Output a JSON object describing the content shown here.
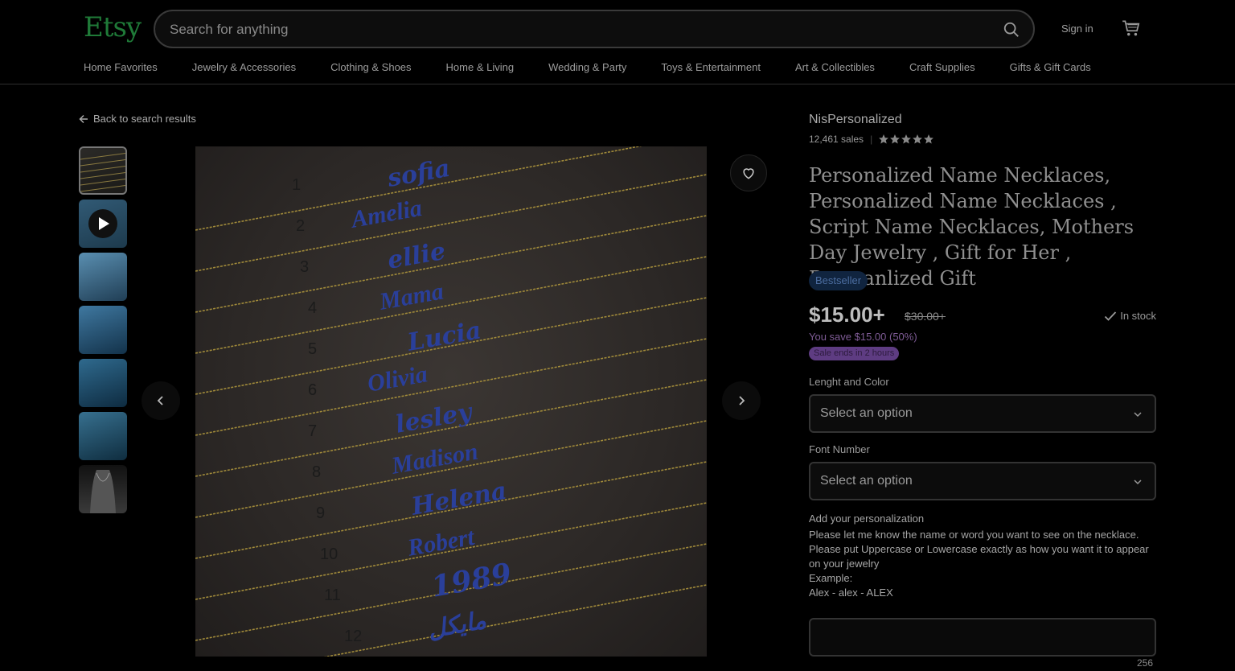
{
  "header": {
    "logo": "Etsy",
    "search_placeholder": "Search for anything",
    "sign_in": "Sign in"
  },
  "nav": [
    "Home Favorites",
    "Jewelry & Accessories",
    "Clothing & Shoes",
    "Home & Living",
    "Wedding & Party",
    "Toys & Entertainment",
    "Art & Collectibles",
    "Craft Supplies",
    "Gifts & Gift Cards"
  ],
  "back_link": "Back to search results",
  "gallery": {
    "thumbnail_count": 7,
    "image_labels": [
      {
        "num": "1",
        "name": "sofia"
      },
      {
        "num": "2",
        "name": "Amelia"
      },
      {
        "num": "3",
        "name": "ellie"
      },
      {
        "num": "4",
        "name": "Mama"
      },
      {
        "num": "5",
        "name": "Lucia"
      },
      {
        "num": "6",
        "name": "Olivia"
      },
      {
        "num": "7",
        "name": "lesley"
      },
      {
        "num": "8",
        "name": "Madison"
      },
      {
        "num": "9",
        "name": "Helena"
      },
      {
        "num": "10",
        "name": "Robert"
      },
      {
        "num": "11",
        "name": "1989"
      },
      {
        "num": "12",
        "name": "مايكل"
      }
    ]
  },
  "product": {
    "shop_name": "NisPersonalized",
    "sales": "12,461 sales",
    "rating": 5,
    "title": "Personalized Name Necklaces, Personalized Name Necklaces , Script Name Necklaces, Mothers Day Jewelry , Gift for Her , Persoanlized Gift",
    "badge": "Bestseller",
    "price": "$15.00+",
    "old_price": "$30.00+",
    "stock": "In stock",
    "you_save": "You save $15.00 (50%)",
    "sale_badge": "Sale ends in 2 hours",
    "option1_label": "Lenght and Color",
    "option1_value": "Select an option",
    "option2_label": "Font Number",
    "option2_value": "Select an option",
    "personalization_label": "Add your personalization",
    "personalization_lines": [
      "Please let me know the name or word you want to see on the necklace.",
      "Please put Uppercase or Lowercase exactly as how you want it to appear on your jewelry",
      "Example:",
      "Alex - alex - ALEX"
    ],
    "char_counter": "256"
  },
  "colors": {
    "brand": "#1f7a38",
    "badge_bg": "#10243f",
    "sale_bg": "#5e3c82",
    "name_blue": "#2a3f9a"
  }
}
